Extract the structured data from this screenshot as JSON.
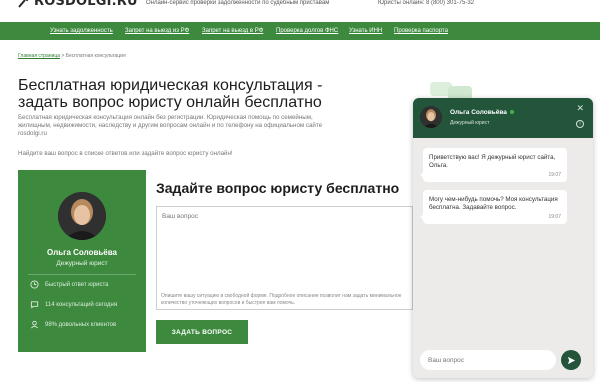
{
  "header": {
    "logo_text": "ROSDOLGI.RU",
    "tagline": "Онлайн-сервис проверки задолженности по судебным приставам",
    "phone": "Юристы онлайн: 8 (800) 301-75-32"
  },
  "nav": {
    "items": [
      "Узнать задолженность",
      "Запрет на выезд из РФ",
      "Запрет на выезд в РФ",
      "Проверка долгов ФНС",
      "Узнать ИНН",
      "Проверка паспорта"
    ]
  },
  "breadcrumb": {
    "home": "Главная страница",
    "separator": ">",
    "current": "Бесплатная консультация"
  },
  "page": {
    "title": "Бесплатная юридическая консультация - задать вопрос юристу онлайн бесплатно",
    "description": "Бесплатная юридическая консультация онлайн без регистрации. Юридическая помощь по семейным, жилищным, недвижимости, наследству и другим вопросам онлайн и по телефону на официальном сайте rosdolgi.ru",
    "hint": "Найдите ваш вопрос в списке ответов или задайте вопрос юристу онлайн!"
  },
  "lawyer_card": {
    "name": "Ольга Соловьёва",
    "role": "Дежурный юрист",
    "features": [
      "Быстрый ответ юриста",
      "114 консультаций сегодня",
      "98% довольных клиентов"
    ]
  },
  "form": {
    "title": "Задайте вопрос юристу бесплатно",
    "textarea_placeholder": "Ваш вопрос",
    "help_text": "Опишите вашу ситуацию в свободной форме. Подробное описание позволит нам задать минимальное количество уточняющих вопросов и быстрее вам помочь.",
    "submit_label": "ЗАДАТЬ ВОПРОС"
  },
  "chat": {
    "agent_name": "Ольга Соловьёва",
    "agent_role": "Дежурный юрист",
    "close_glyph": "✕",
    "info_glyph": "i",
    "messages": [
      {
        "text": "Приветствую вас! Я дежурный юрист сайта, Ольга.",
        "time": "19:07"
      },
      {
        "text": "Могу чем-нибудь помочь? Моя консультация бесплатна. Задавайте вопрос.",
        "time": "19:07"
      }
    ],
    "input_placeholder": "Ваш вопрос"
  },
  "colors": {
    "brand_green": "#3d8a3f",
    "chat_header": "#22553a",
    "online": "#4caf50"
  }
}
